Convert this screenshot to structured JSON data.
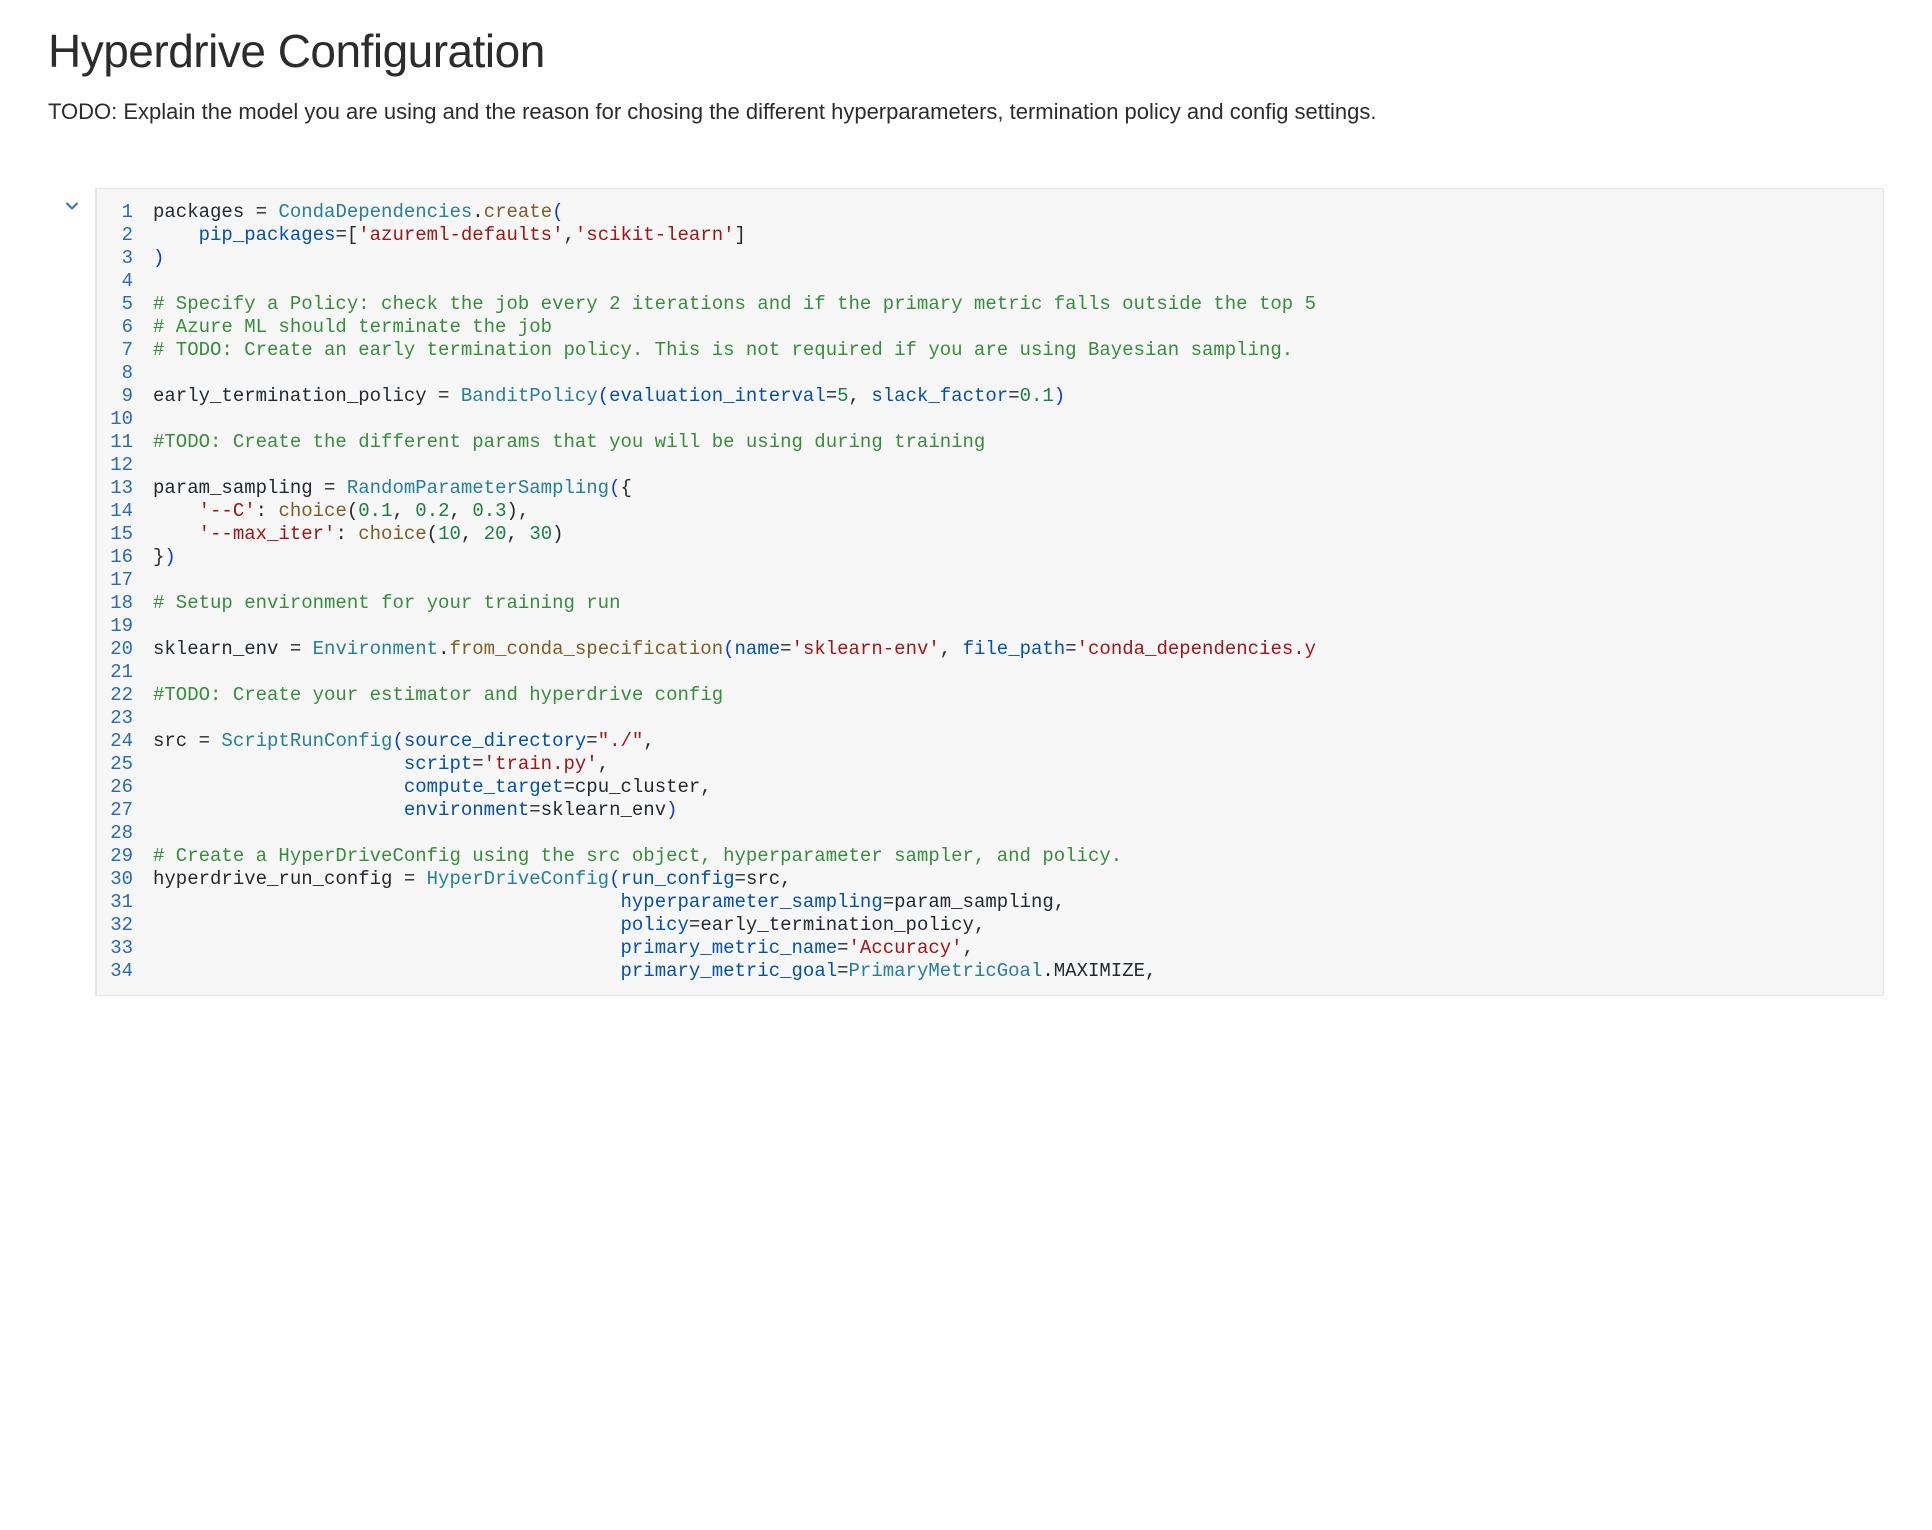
{
  "markdown": {
    "heading": "Hyperdrive Configuration",
    "body": "TODO: Explain the model you are using and the reason for chosing the different hyperparameters, termination policy and config settings."
  },
  "gutter": {
    "chevron": "chevron-down"
  },
  "code": {
    "lines": [
      {
        "n": "1",
        "tokens": [
          [
            "pln",
            "packages "
          ],
          [
            "op",
            "="
          ],
          [
            "pln",
            " "
          ],
          [
            "cls",
            "CondaDependencies"
          ],
          [
            "op",
            "."
          ],
          [
            "func",
            "create"
          ],
          [
            "paren",
            "("
          ]
        ]
      },
      {
        "n": "2",
        "tokens": [
          [
            "pln",
            "    "
          ],
          [
            "kwarg",
            "pip_packages"
          ],
          [
            "op",
            "=["
          ],
          [
            "str",
            "'azureml-defaults'"
          ],
          [
            "op",
            ","
          ],
          [
            "str",
            "'scikit-learn'"
          ],
          [
            "op",
            "]"
          ]
        ]
      },
      {
        "n": "3",
        "tokens": [
          [
            "paren",
            ")"
          ]
        ]
      },
      {
        "n": "4",
        "tokens": [
          [
            "pln",
            ""
          ]
        ]
      },
      {
        "n": "5",
        "tokens": [
          [
            "cmnt",
            "# Specify a Policy: check the job every 2 iterations and if the primary metric falls outside the top 5"
          ]
        ]
      },
      {
        "n": "6",
        "tokens": [
          [
            "cmnt",
            "# Azure ML should terminate the job"
          ]
        ]
      },
      {
        "n": "7",
        "tokens": [
          [
            "cmnt",
            "# TODO: Create an early termination policy. This is not required if you are using Bayesian sampling."
          ]
        ]
      },
      {
        "n": "8",
        "tokens": [
          [
            "pln",
            ""
          ]
        ]
      },
      {
        "n": "9",
        "tokens": [
          [
            "pln",
            "early_termination_policy "
          ],
          [
            "op",
            "="
          ],
          [
            "pln",
            " "
          ],
          [
            "cls",
            "BanditPolicy"
          ],
          [
            "paren",
            "("
          ],
          [
            "kwarg",
            "evaluation_interval"
          ],
          [
            "op",
            "="
          ],
          [
            "num",
            "5"
          ],
          [
            "op",
            ", "
          ],
          [
            "kwarg",
            "slack_factor"
          ],
          [
            "op",
            "="
          ],
          [
            "num",
            "0.1"
          ],
          [
            "paren",
            ")"
          ]
        ]
      },
      {
        "n": "10",
        "tokens": [
          [
            "pln",
            ""
          ]
        ]
      },
      {
        "n": "11",
        "tokens": [
          [
            "cmnt",
            "#TODO: Create the different params that you will be using during training"
          ]
        ]
      },
      {
        "n": "12",
        "tokens": [
          [
            "pln",
            ""
          ]
        ]
      },
      {
        "n": "13",
        "tokens": [
          [
            "pln",
            "param_sampling "
          ],
          [
            "op",
            "="
          ],
          [
            "pln",
            " "
          ],
          [
            "cls",
            "RandomParameterSampling"
          ],
          [
            "paren",
            "("
          ],
          [
            "op",
            "{"
          ]
        ]
      },
      {
        "n": "14",
        "tokens": [
          [
            "pln",
            "    "
          ],
          [
            "str",
            "'--C'"
          ],
          [
            "op",
            ": "
          ],
          [
            "func",
            "choice"
          ],
          [
            "paren2",
            "("
          ],
          [
            "num",
            "0.1"
          ],
          [
            "op",
            ", "
          ],
          [
            "num",
            "0.2"
          ],
          [
            "op",
            ", "
          ],
          [
            "num",
            "0.3"
          ],
          [
            "paren2",
            ")"
          ],
          [
            "op",
            ","
          ]
        ]
      },
      {
        "n": "15",
        "tokens": [
          [
            "pln",
            "    "
          ],
          [
            "str",
            "'--max_iter'"
          ],
          [
            "op",
            ": "
          ],
          [
            "func",
            "choice"
          ],
          [
            "paren2",
            "("
          ],
          [
            "num",
            "10"
          ],
          [
            "op",
            ", "
          ],
          [
            "num",
            "20"
          ],
          [
            "op",
            ", "
          ],
          [
            "num",
            "30"
          ],
          [
            "paren2",
            ")"
          ]
        ]
      },
      {
        "n": "16",
        "tokens": [
          [
            "op",
            "}"
          ],
          [
            "paren",
            ")"
          ]
        ]
      },
      {
        "n": "17",
        "tokens": [
          [
            "pln",
            ""
          ]
        ]
      },
      {
        "n": "18",
        "tokens": [
          [
            "cmnt",
            "# Setup environment for your training run"
          ]
        ]
      },
      {
        "n": "19",
        "tokens": [
          [
            "pln",
            ""
          ]
        ]
      },
      {
        "n": "20",
        "tokens": [
          [
            "pln",
            "sklearn_env "
          ],
          [
            "op",
            "="
          ],
          [
            "pln",
            " "
          ],
          [
            "cls",
            "Environment"
          ],
          [
            "op",
            "."
          ],
          [
            "func",
            "from_conda_specification"
          ],
          [
            "paren",
            "("
          ],
          [
            "kwarg",
            "name"
          ],
          [
            "op",
            "="
          ],
          [
            "str",
            "'sklearn-env'"
          ],
          [
            "op",
            ", "
          ],
          [
            "kwarg",
            "file_path"
          ],
          [
            "op",
            "="
          ],
          [
            "str",
            "'conda_dependencies.y"
          ]
        ]
      },
      {
        "n": "21",
        "tokens": [
          [
            "pln",
            ""
          ]
        ]
      },
      {
        "n": "22",
        "tokens": [
          [
            "cmnt",
            "#TODO: Create your estimator and hyperdrive config"
          ]
        ]
      },
      {
        "n": "23",
        "tokens": [
          [
            "pln",
            ""
          ]
        ]
      },
      {
        "n": "24",
        "tokens": [
          [
            "pln",
            "src "
          ],
          [
            "op",
            "="
          ],
          [
            "pln",
            " "
          ],
          [
            "cls",
            "ScriptRunConfig"
          ],
          [
            "paren",
            "("
          ],
          [
            "kwarg",
            "source_directory"
          ],
          [
            "op",
            "="
          ],
          [
            "str",
            "\"./\""
          ],
          [
            "op",
            ","
          ]
        ]
      },
      {
        "n": "25",
        "tokens": [
          [
            "pln",
            "                      "
          ],
          [
            "kwarg",
            "script"
          ],
          [
            "op",
            "="
          ],
          [
            "str",
            "'train.py'"
          ],
          [
            "op",
            ","
          ]
        ]
      },
      {
        "n": "26",
        "tokens": [
          [
            "pln",
            "                      "
          ],
          [
            "kwarg",
            "compute_target"
          ],
          [
            "op",
            "="
          ],
          [
            "pln",
            "cpu_cluster,"
          ]
        ]
      },
      {
        "n": "27",
        "tokens": [
          [
            "pln",
            "                      "
          ],
          [
            "kwarg",
            "environment"
          ],
          [
            "op",
            "="
          ],
          [
            "pln",
            "sklearn_env"
          ],
          [
            "paren",
            ")"
          ]
        ]
      },
      {
        "n": "28",
        "tokens": [
          [
            "pln",
            ""
          ]
        ]
      },
      {
        "n": "29",
        "tokens": [
          [
            "cmnt",
            "# Create a HyperDriveConfig using the src object, hyperparameter sampler, and policy."
          ]
        ]
      },
      {
        "n": "30",
        "tokens": [
          [
            "pln",
            "hyperdrive_run_config "
          ],
          [
            "op",
            "="
          ],
          [
            "pln",
            " "
          ],
          [
            "cls",
            "HyperDriveConfig"
          ],
          [
            "paren",
            "("
          ],
          [
            "kwarg",
            "run_config"
          ],
          [
            "op",
            "="
          ],
          [
            "pln",
            "src,"
          ]
        ]
      },
      {
        "n": "31",
        "tokens": [
          [
            "pln",
            "                                         "
          ],
          [
            "kwarg",
            "hyperparameter_sampling"
          ],
          [
            "op",
            "="
          ],
          [
            "pln",
            "param_sampling,"
          ]
        ]
      },
      {
        "n": "32",
        "tokens": [
          [
            "pln",
            "                                         "
          ],
          [
            "kwarg",
            "policy"
          ],
          [
            "op",
            "="
          ],
          [
            "pln",
            "early_termination_policy,"
          ]
        ]
      },
      {
        "n": "33",
        "tokens": [
          [
            "pln",
            "                                         "
          ],
          [
            "kwarg",
            "primary_metric_name"
          ],
          [
            "op",
            "="
          ],
          [
            "str",
            "'Accuracy'"
          ],
          [
            "op",
            ","
          ]
        ]
      },
      {
        "n": "34",
        "tokens": [
          [
            "pln",
            "                                         "
          ],
          [
            "kwarg",
            "primary_metric_goal"
          ],
          [
            "op",
            "="
          ],
          [
            "cls",
            "PrimaryMetricGoal"
          ],
          [
            "op",
            "."
          ],
          [
            "pln",
            "MAXIMIZE,"
          ]
        ]
      }
    ]
  }
}
